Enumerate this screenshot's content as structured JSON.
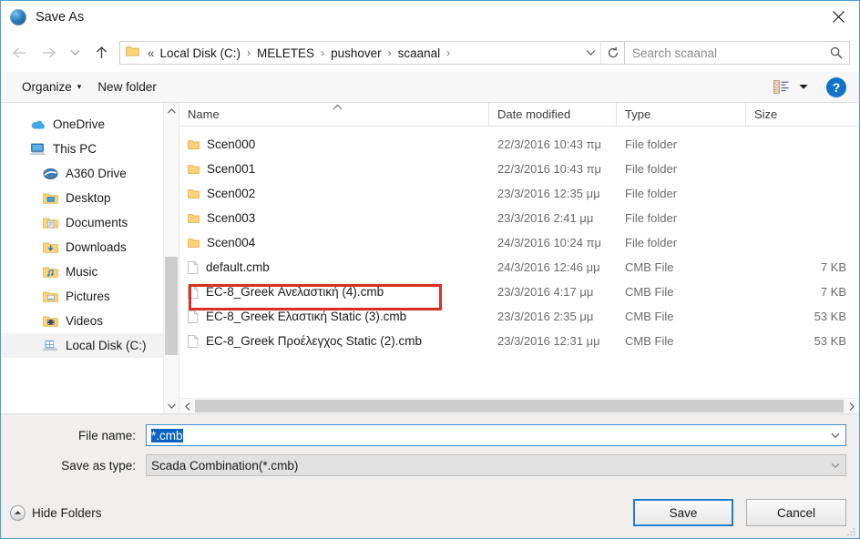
{
  "window": {
    "title": "Save As",
    "app_icon": "globe-icon",
    "close_label": "✕"
  },
  "navigation": {
    "back_label": "←",
    "forward_label": "→",
    "recent_label": "⌄",
    "up_label": "↑"
  },
  "address": {
    "folder_icon": "folder-icon",
    "ellipsis": "«",
    "crumbs": [
      "Local Disk (C:)",
      "MELETES",
      "pushover",
      "scaanal"
    ],
    "separator": "›",
    "dropdown_icon": "chevron-down-icon",
    "refresh_icon": "refresh-icon"
  },
  "search": {
    "placeholder": "Search scaanal",
    "value": "",
    "icon": "search-icon"
  },
  "commandbar": {
    "organize_label": "Organize",
    "organize_caret": "▾",
    "new_folder_label": "New folder",
    "view_icon": "list-view-icon",
    "view_caret_icon": "chevron-down-icon",
    "help_label": "?"
  },
  "sidebar": {
    "items": [
      {
        "label": "OneDrive",
        "icon": "onedrive-cloud-icon",
        "depth": 0,
        "selected": false
      },
      {
        "label": "This PC",
        "icon": "this-pc-icon",
        "depth": 0,
        "selected": false
      },
      {
        "label": "A360 Drive",
        "icon": "a360-drive-icon",
        "depth": 2,
        "selected": false
      },
      {
        "label": "Desktop",
        "icon": "desktop-folder-icon",
        "depth": 2,
        "selected": false
      },
      {
        "label": "Documents",
        "icon": "documents-folder-icon",
        "depth": 2,
        "selected": false
      },
      {
        "label": "Downloads",
        "icon": "downloads-folder-icon",
        "depth": 2,
        "selected": false
      },
      {
        "label": "Music",
        "icon": "music-folder-icon",
        "depth": 2,
        "selected": false
      },
      {
        "label": "Pictures",
        "icon": "pictures-folder-icon",
        "depth": 2,
        "selected": false
      },
      {
        "label": "Videos",
        "icon": "videos-folder-icon",
        "depth": 2,
        "selected": false
      },
      {
        "label": "Local Disk (C:)",
        "icon": "local-disk-icon",
        "depth": 2,
        "selected": true
      }
    ],
    "scroll_up_icon": "chevron-up-icon",
    "scroll_down_icon": "chevron-down-icon"
  },
  "filelist": {
    "columns": [
      "Name",
      "Date modified",
      "Type",
      "Size"
    ],
    "sort_column": "Name",
    "sort_direction": "ascending",
    "rows": [
      {
        "name": "Scen000",
        "icon": "folder-icon",
        "date": "22/3/2016 10:43 πμ",
        "type": "File folder",
        "size": "",
        "highlighted": false
      },
      {
        "name": "Scen001",
        "icon": "folder-icon",
        "date": "22/3/2016 10:43 πμ",
        "type": "File folder",
        "size": "",
        "highlighted": false
      },
      {
        "name": "Scen002",
        "icon": "folder-icon",
        "date": "23/3/2016 12:35 μμ",
        "type": "File folder",
        "size": "",
        "highlighted": false
      },
      {
        "name": "Scen003",
        "icon": "folder-icon",
        "date": "23/3/2016 2:41 μμ",
        "type": "File folder",
        "size": "",
        "highlighted": false
      },
      {
        "name": "Scen004",
        "icon": "folder-icon",
        "date": "24/3/2016 10:24 πμ",
        "type": "File folder",
        "size": "",
        "highlighted": false
      },
      {
        "name": "default.cmb",
        "icon": "file-icon",
        "date": "24/3/2016 12:46 μμ",
        "type": "CMB File",
        "size": "7 KB",
        "highlighted": false
      },
      {
        "name": "EC-8_Greek Ανελαστική (4).cmb",
        "icon": "file-icon",
        "date": "23/3/2016 4:17 μμ",
        "type": "CMB File",
        "size": "7 KB",
        "highlighted": true
      },
      {
        "name": "EC-8_Greek Ελαστική Static (3).cmb",
        "icon": "file-icon",
        "date": "23/3/2016 2:35 μμ",
        "type": "CMB File",
        "size": "53 KB",
        "highlighted": false
      },
      {
        "name": "EC-8_Greek Προέλεγχος Static (2).cmb",
        "icon": "file-icon",
        "date": "23/3/2016 12:31 μμ",
        "type": "CMB File",
        "size": "53 KB",
        "highlighted": false
      }
    ],
    "annotation_color": "#d93025",
    "hscroll_left_icon": "chevron-left-icon",
    "hscroll_right_icon": "chevron-right-icon"
  },
  "form": {
    "filename_label": "File name:",
    "filename_value": "*.cmb",
    "filename_selected": true,
    "filetype_label": "Save as type:",
    "filetype_value": "Scada Combination(*.cmb)",
    "caret_icon": "chevron-down-icon"
  },
  "footer": {
    "hide_folders_label": "Hide Folders",
    "hide_folders_icon": "chevron-up-circle-icon",
    "save_label": "Save",
    "cancel_label": "Cancel"
  },
  "colors": {
    "accent": "#1b7fd0",
    "window_border": "#4a9fd4",
    "selection": "#0b64c4",
    "annotation": "#d93025",
    "chrome_bg": "#f0efee"
  }
}
